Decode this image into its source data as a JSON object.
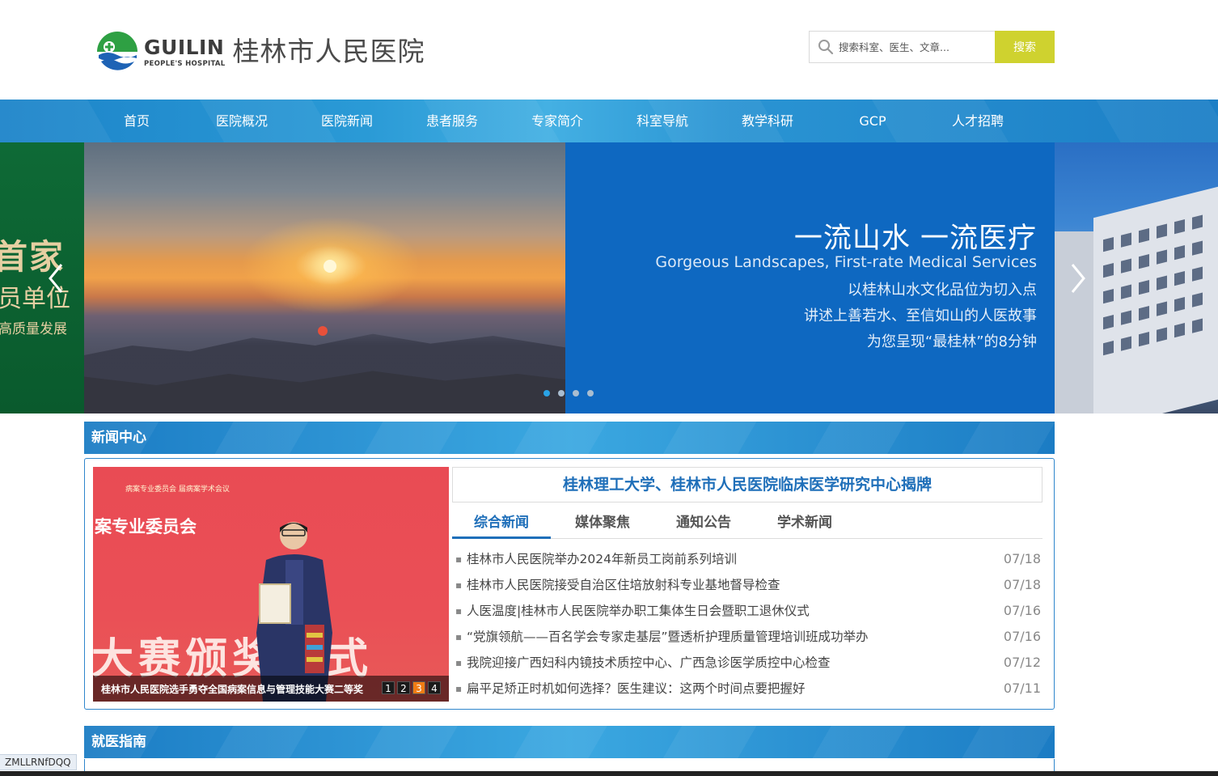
{
  "header": {
    "logo_en": "GUILIN",
    "logo_en_sub": "PEOPLE'S HOSPITAL",
    "logo_cn": "桂林市人民医院",
    "search_placeholder": "搜索科室、医生、文章...",
    "search_button": "搜索"
  },
  "nav": {
    "items": [
      "首页",
      "医院概况",
      "医院新闻",
      "患者服务",
      "专家简介",
      "科室导航",
      "教学科研",
      "GCP",
      "人才招聘"
    ]
  },
  "banner": {
    "left_line1": "首家",
    "left_line2": "员单位",
    "left_line3": "高质量发展",
    "title": "一流山水 一流医疗",
    "subtitle": "Gorgeous Landscapes, First-rate Medical Services",
    "lines": [
      "以桂林山水文化品位为切入点",
      "讲述上善若水、至信如山的人医故事",
      "为您呈现“最桂林”的8分钟"
    ],
    "dots_total": 4,
    "dots_active": 1
  },
  "news_center": {
    "section_title": "新闻中心",
    "photo_caption_top": "案专业委员会",
    "photo_small_text": "病案专业委员会\n届病案学术会议",
    "photo_big_text": "大赛颁奖仪式",
    "photo_title": "桂林市人民医院选手勇夺全国病案信息与管理技能大赛二等奖",
    "pager": [
      "1",
      "2",
      "3",
      "4"
    ],
    "pager_active": "3",
    "headline": "桂林理工大学、桂林市人民医院临床医学研究中心揭牌",
    "tabs": [
      "综合新闻",
      "媒体聚焦",
      "通知公告",
      "学术新闻"
    ],
    "active_tab": "综合新闻",
    "items": [
      {
        "title": "桂林市人民医院举办2024年新员工岗前系列培训",
        "date": "07/18"
      },
      {
        "title": "桂林市人民医院接受自治区住培放射科专业基地督导检查",
        "date": "07/18"
      },
      {
        "title": "人医温度|桂林市人民医院举办职工集体生日会暨职工退休仪式",
        "date": "07/16"
      },
      {
        "title": "“党旗领航——百名学会专家走基层”暨透析护理质量管理培训班成功举办",
        "date": "07/16"
      },
      {
        "title": "我院迎接广西妇科内镜技术质控中心、广西急诊医学质控中心检查",
        "date": "07/12"
      },
      {
        "title": "扁平足矫正时机如何选择？医生建议：这两个时间点要把握好",
        "date": "07/11"
      }
    ]
  },
  "guide": {
    "section_title": "就医指南"
  },
  "status": {
    "tooltip": "ZMLLRNfDQQ"
  },
  "colors": {
    "nav_blue": "#2a94d3",
    "accent_blue": "#1f6fb9",
    "search_button": "#cfd22f",
    "pager_active": "#f07c14",
    "banner_blue": "#0e68c1"
  }
}
